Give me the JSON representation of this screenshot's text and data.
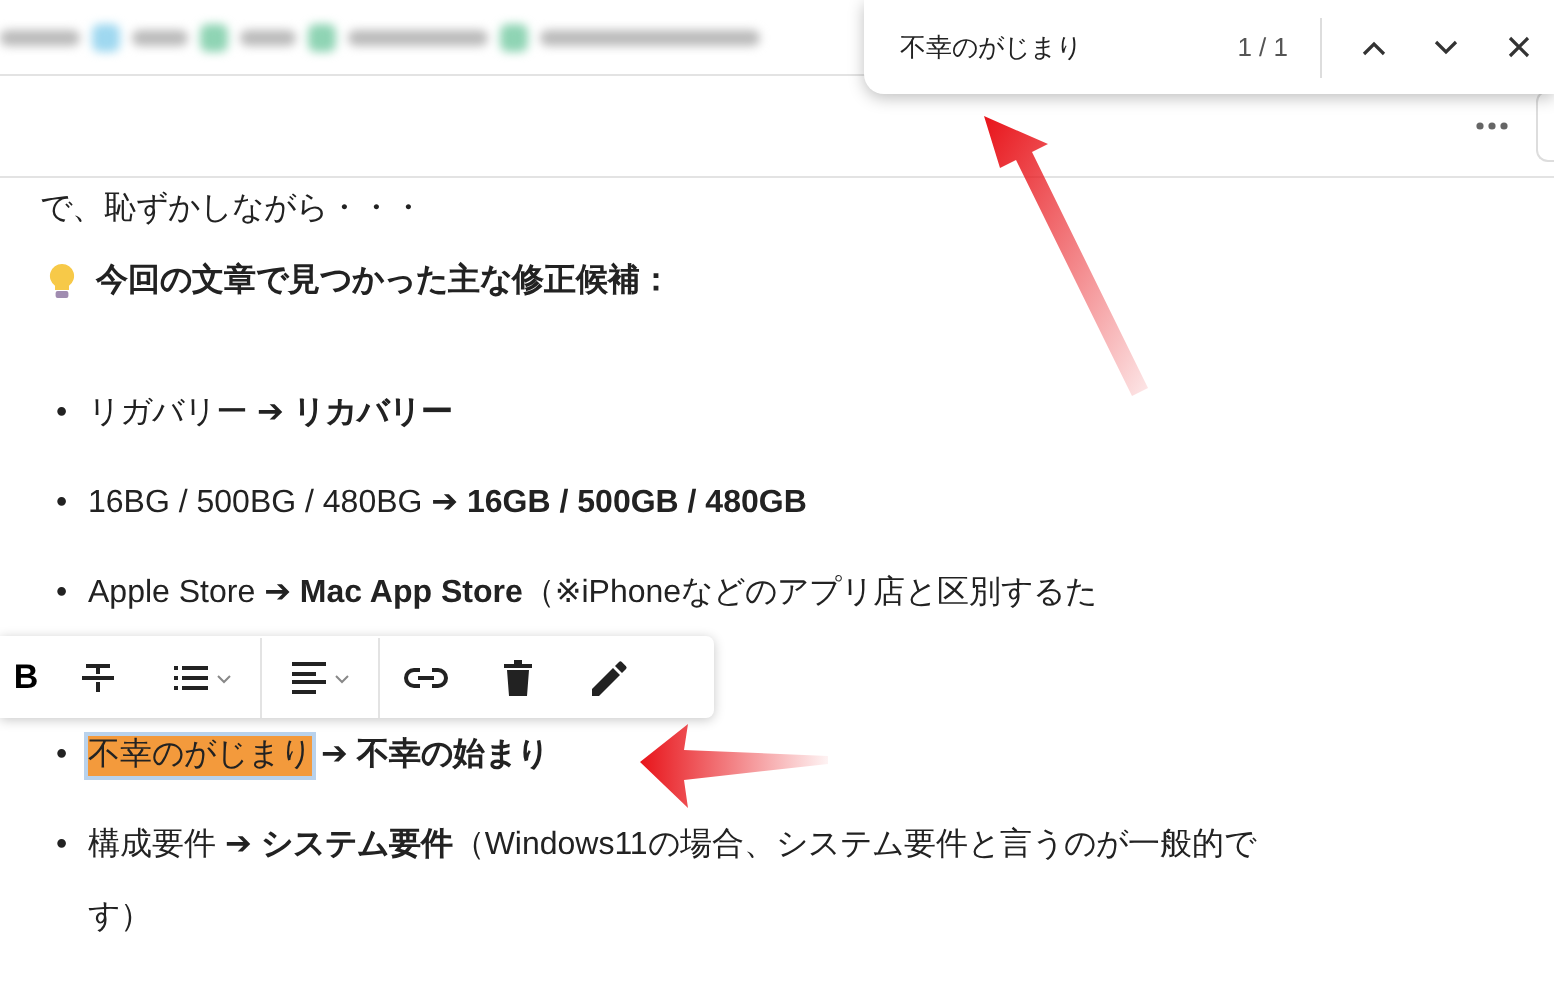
{
  "find_bar": {
    "query": "不幸のがじまり",
    "count": "1 / 1"
  },
  "editor": {
    "intro": "で、恥ずかしながら・・・",
    "heading": "今回の文章で見つかった主な修正候補：",
    "items": [
      {
        "kind": "plain",
        "bullet": "•",
        "text": "リガバリー **➔ リカバリー**"
      },
      {
        "kind": "plain",
        "bullet": "•",
        "text": "16BG / 500BG / 480BG **➔ 16GB / 500GB / 480GB**"
      },
      {
        "kind": "covered",
        "bullet": "•",
        "text": "Apple Store **➔ Mac App Store**（※iPhoneなどのアプリ店と区別するた"
      },
      {
        "kind": "match",
        "bullet": "•",
        "match": "不幸のがじまり",
        "text": "**➔ 不幸の始まり**"
      },
      {
        "kind": "plain",
        "bullet": "•",
        "text": "構成要件 **➔ システム要件**（Windows11の場合、システム要件と言うのが一般的です）"
      }
    ]
  },
  "format_toolbar": {
    "bold": "B"
  }
}
